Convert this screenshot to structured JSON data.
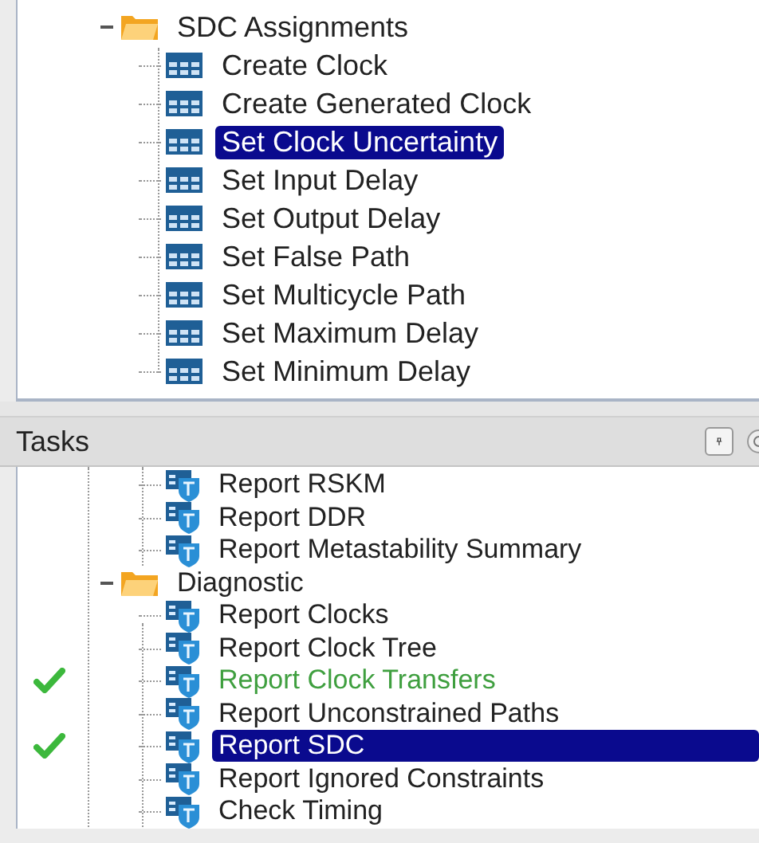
{
  "assignments_tree": {
    "items": [
      {
        "kind": "folder",
        "label": "SDC Assignments",
        "expanded": true,
        "selected": false,
        "children": [
          {
            "kind": "table",
            "label": "Create Clock",
            "selected": false
          },
          {
            "kind": "table",
            "label": "Create Generated Clock",
            "selected": false
          },
          {
            "kind": "table",
            "label": "Set Clock Uncertainty",
            "selected": true
          },
          {
            "kind": "table",
            "label": "Set Input Delay",
            "selected": false
          },
          {
            "kind": "table",
            "label": "Set Output Delay",
            "selected": false
          },
          {
            "kind": "table",
            "label": "Set False Path",
            "selected": false
          },
          {
            "kind": "table",
            "label": "Set Multicycle Path",
            "selected": false
          },
          {
            "kind": "table",
            "label": "Set Maximum Delay",
            "selected": false
          },
          {
            "kind": "table",
            "label": "Set Minimum Delay",
            "selected": false
          }
        ]
      }
    ]
  },
  "tasks": {
    "title": "Tasks",
    "items": [
      {
        "kind": "report",
        "label": "Report RSKM",
        "selected": false,
        "completed": false
      },
      {
        "kind": "report",
        "label": "Report DDR",
        "selected": false,
        "completed": false
      },
      {
        "kind": "report",
        "label": "Report Metastability Summary",
        "selected": false,
        "completed": false
      },
      {
        "kind": "folder",
        "label": "Diagnostic",
        "expanded": true,
        "selected": false,
        "completed": false,
        "children": [
          {
            "kind": "report",
            "label": "Report Clocks",
            "selected": false,
            "completed": false
          },
          {
            "kind": "report",
            "label": "Report Clock Tree",
            "selected": false,
            "completed": false
          },
          {
            "kind": "report",
            "label": "Report Clock Transfers",
            "selected": false,
            "completed": true
          },
          {
            "kind": "report",
            "label": "Report Unconstrained Paths",
            "selected": false,
            "completed": false
          },
          {
            "kind": "report",
            "label": "Report SDC",
            "selected": true,
            "completed": true
          },
          {
            "kind": "report",
            "label": "Report Ignored Constraints",
            "selected": false,
            "completed": false
          },
          {
            "kind": "report",
            "label": "Check Timing",
            "selected": false,
            "completed": false
          }
        ]
      }
    ]
  }
}
